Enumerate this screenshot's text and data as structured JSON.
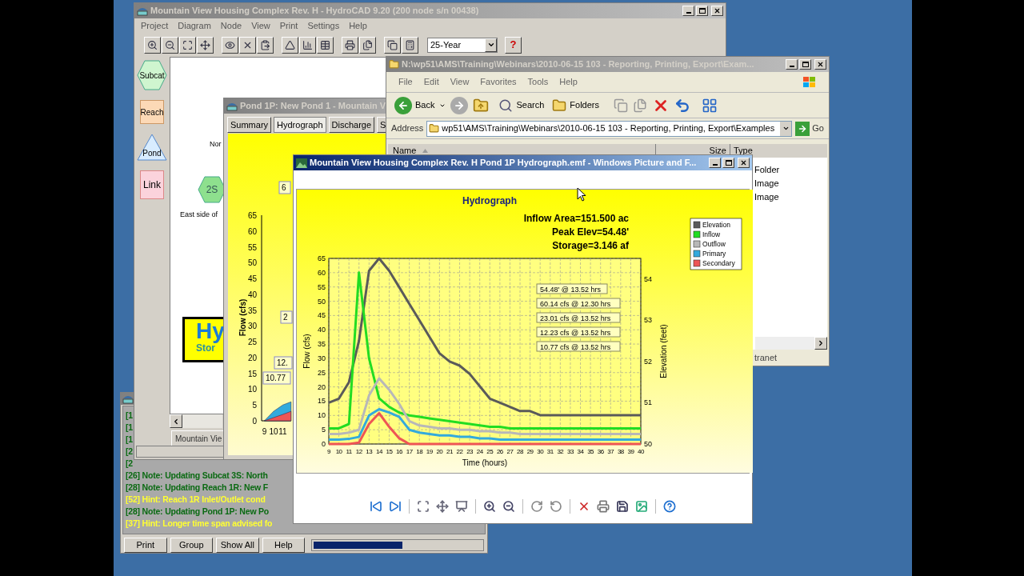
{
  "log_window": {
    "lines": [
      {
        "text": "[1",
        "kind": "note"
      },
      {
        "text": "[1",
        "kind": "note"
      },
      {
        "text": "[1",
        "kind": "note"
      },
      {
        "text": "[2",
        "kind": "note"
      },
      {
        "text": "[2",
        "kind": "note"
      },
      {
        "text": "[26] Note: Updating Subcat 3S: North",
        "kind": "note"
      },
      {
        "text": "[28] Note: Updating Reach 1R: New F",
        "kind": "note"
      },
      {
        "text": "[52] Hint: Reach 1R Inlet/Outlet cond",
        "kind": "hint"
      },
      {
        "text": "[28] Note: Updating Pond 1P: New Po",
        "kind": "note"
      },
      {
        "text": "[37] Hint: Longer time span advised fo",
        "kind": "hint"
      }
    ],
    "buttons": [
      "Print",
      "Group",
      "Show All",
      "Help"
    ],
    "progress": {
      "level": 0.53
    }
  },
  "main_window": {
    "title": "Mountain View Housing Complex Rev. H - HydroCAD 9.20 (200 node s/n 00438)",
    "menu": [
      "Project",
      "Diagram",
      "Node",
      "View",
      "Print",
      "Settings",
      "Help"
    ],
    "storm_select": {
      "value": "25-Year"
    },
    "help_button": "?",
    "palette": [
      {
        "label": "Subcat",
        "kind": "subcat"
      },
      {
        "label": "Reach",
        "kind": "reach"
      },
      {
        "label": "Pond",
        "kind": "pond"
      },
      {
        "label": "Link",
        "kind": "link"
      }
    ],
    "canvas": {
      "texts": [
        "Nor",
        "East side of"
      ],
      "node": {
        "label": "2S",
        "kind": "subcat"
      },
      "logo": {
        "title": "Hy",
        "subtitle": "Stor"
      }
    },
    "tab": "Mountain Vie"
  },
  "pond_window": {
    "title": "Pond 1P: New Pond 1 - Mountain V",
    "tabs": [
      {
        "label": "Summary",
        "selected": false
      },
      {
        "label": "Hydrograph",
        "selected": true
      },
      {
        "label": "Discharge",
        "selected": false
      },
      {
        "label": "S",
        "selected": false
      }
    ],
    "chart_data": {
      "type": "area",
      "ylabel": "Flow (cfs)",
      "ylim": [
        0,
        65
      ],
      "yticks": [
        0,
        5,
        10,
        15,
        20,
        25,
        30,
        35,
        40,
        45,
        50,
        55,
        60,
        65
      ],
      "xlim": [
        8.7,
        11.9
      ],
      "xticks": [
        9,
        10,
        11
      ],
      "x": [
        9,
        10,
        11,
        11.9
      ],
      "series": [
        {
          "color": "#33aadd",
          "values": [
            0,
            3,
            5,
            6
          ]
        },
        {
          "color": "#ee5555",
          "values": [
            0,
            1,
            2,
            3
          ]
        }
      ],
      "annotations": [
        "6",
        "2",
        "12.",
        "10.77"
      ]
    }
  },
  "explorer": {
    "title": "N:\\wp51\\AMS\\Training\\Webinars\\2010-06-15 103 - Reporting, Printing, Export\\Exam...",
    "menu": [
      "File",
      "Edit",
      "View",
      "Favorites",
      "Tools",
      "Help"
    ],
    "toolbar": {
      "back": "Back",
      "search": "Search",
      "folders": "Folders"
    },
    "address_label": "Address",
    "address": "wp51\\AMS\\Training\\Webinars\\2010-06-15 103 - Reporting, Printing, Export\\Examples",
    "go": "Go",
    "columns": [
      "Name",
      "Size",
      "Type"
    ],
    "rows": [
      "Folder",
      "Image",
      "Image"
    ],
    "status": "tranet"
  },
  "viewer": {
    "title": "Mountain View Housing Complex Rev. H Pond 1P Hydrograph.emf - Windows Picture and F...",
    "info_lines": [
      "Inflow Area=151.500 ac",
      "Peak Elev=54.48'",
      "Storage=3.146 af"
    ],
    "chart_data": {
      "type": "line",
      "title": "Hydrograph",
      "xlabel": "Time (hours)",
      "ylabel": "Flow (cfs)",
      "y2label": "Elevation (feet)",
      "legend": "right",
      "x": [
        9,
        10,
        11,
        12,
        13,
        14,
        15,
        16,
        17,
        18,
        19,
        20,
        21,
        22,
        23,
        24,
        25,
        26,
        27,
        28,
        29,
        30,
        31,
        32,
        33,
        34,
        35,
        36,
        37,
        38,
        39,
        40
      ],
      "grid": true,
      "xlim": [
        9,
        40
      ],
      "xticks": [
        9,
        10,
        11,
        12,
        13,
        14,
        15,
        16,
        17,
        18,
        19,
        20,
        21,
        22,
        23,
        24,
        25,
        26,
        27,
        28,
        29,
        30,
        31,
        32,
        33,
        34,
        35,
        36,
        37,
        38,
        39,
        40
      ],
      "ylim": [
        0,
        65
      ],
      "yticks": [
        0,
        5,
        10,
        15,
        20,
        25,
        30,
        35,
        40,
        45,
        50,
        55,
        60,
        65
      ],
      "y2lim": [
        50,
        54.5
      ],
      "y2ticks": [
        50,
        51,
        52,
        53,
        54
      ],
      "series": [
        {
          "name": "Elevation",
          "color": "#5a5a5a",
          "axis": "y2",
          "values": [
            51,
            51.1,
            51.5,
            52.5,
            54.2,
            54.5,
            54.2,
            53.8,
            53.4,
            53,
            52.6,
            52.2,
            52,
            51.9,
            51.7,
            51.4,
            51.1,
            51,
            50.9,
            50.8,
            50.8,
            50.7,
            50.7,
            50.7,
            50.7,
            50.7,
            50.7,
            50.7,
            50.7,
            50.7,
            50.7,
            50.7
          ]
        },
        {
          "name": "Inflow",
          "color": "#22dd22",
          "values": [
            5.5,
            5.5,
            7,
            60,
            30,
            16,
            13,
            11,
            10,
            9.5,
            9,
            8.5,
            8,
            7.5,
            7,
            6.5,
            6,
            6,
            5.5,
            5.5,
            5.5,
            5.5,
            5.5,
            5.5,
            5.5,
            5.5,
            5.5,
            5.5,
            5.5,
            5.5,
            5.5,
            5.5
          ]
        },
        {
          "name": "Outflow",
          "color": "#b8b8b8",
          "values": [
            3.5,
            3.5,
            4,
            5,
            17,
            23,
            19,
            14,
            8,
            6.5,
            6,
            5.5,
            5.5,
            5,
            5,
            4.5,
            4.5,
            4,
            4,
            3.5,
            3.5,
            3.5,
            3.5,
            3.5,
            3.5,
            3.5,
            3.5,
            3.5,
            3.5,
            3.5,
            3.5,
            3.5
          ]
        },
        {
          "name": "Primary",
          "color": "#33aadd",
          "values": [
            1.5,
            1.5,
            1.8,
            2.5,
            10,
            12.2,
            11,
            9.5,
            5,
            4,
            3.5,
            3,
            3,
            2.5,
            2.5,
            2,
            2,
            1.5,
            1.5,
            1.5,
            1.5,
            1.5,
            1.5,
            1.5,
            1.5,
            1.5,
            1.5,
            1.5,
            1.5,
            1.5,
            1.5,
            1.5
          ]
        },
        {
          "name": "Secondary",
          "color": "#ee5555",
          "values": [
            0,
            0,
            0,
            0.5,
            7,
            10.8,
            6,
            2,
            0,
            0,
            0,
            0,
            0,
            0,
            0,
            0,
            0,
            0,
            0,
            0,
            0,
            0,
            0,
            0,
            0,
            0,
            0,
            0,
            0,
            0,
            0,
            0
          ]
        }
      ],
      "annotations": [
        "54.48' @ 13.52 hrs",
        "60.14 cfs @ 12.30 hrs",
        "23.01 cfs @ 13.52 hrs",
        "12.23 cfs @ 13.52 hrs",
        "10.77 cfs @ 13.52 hrs"
      ]
    }
  }
}
